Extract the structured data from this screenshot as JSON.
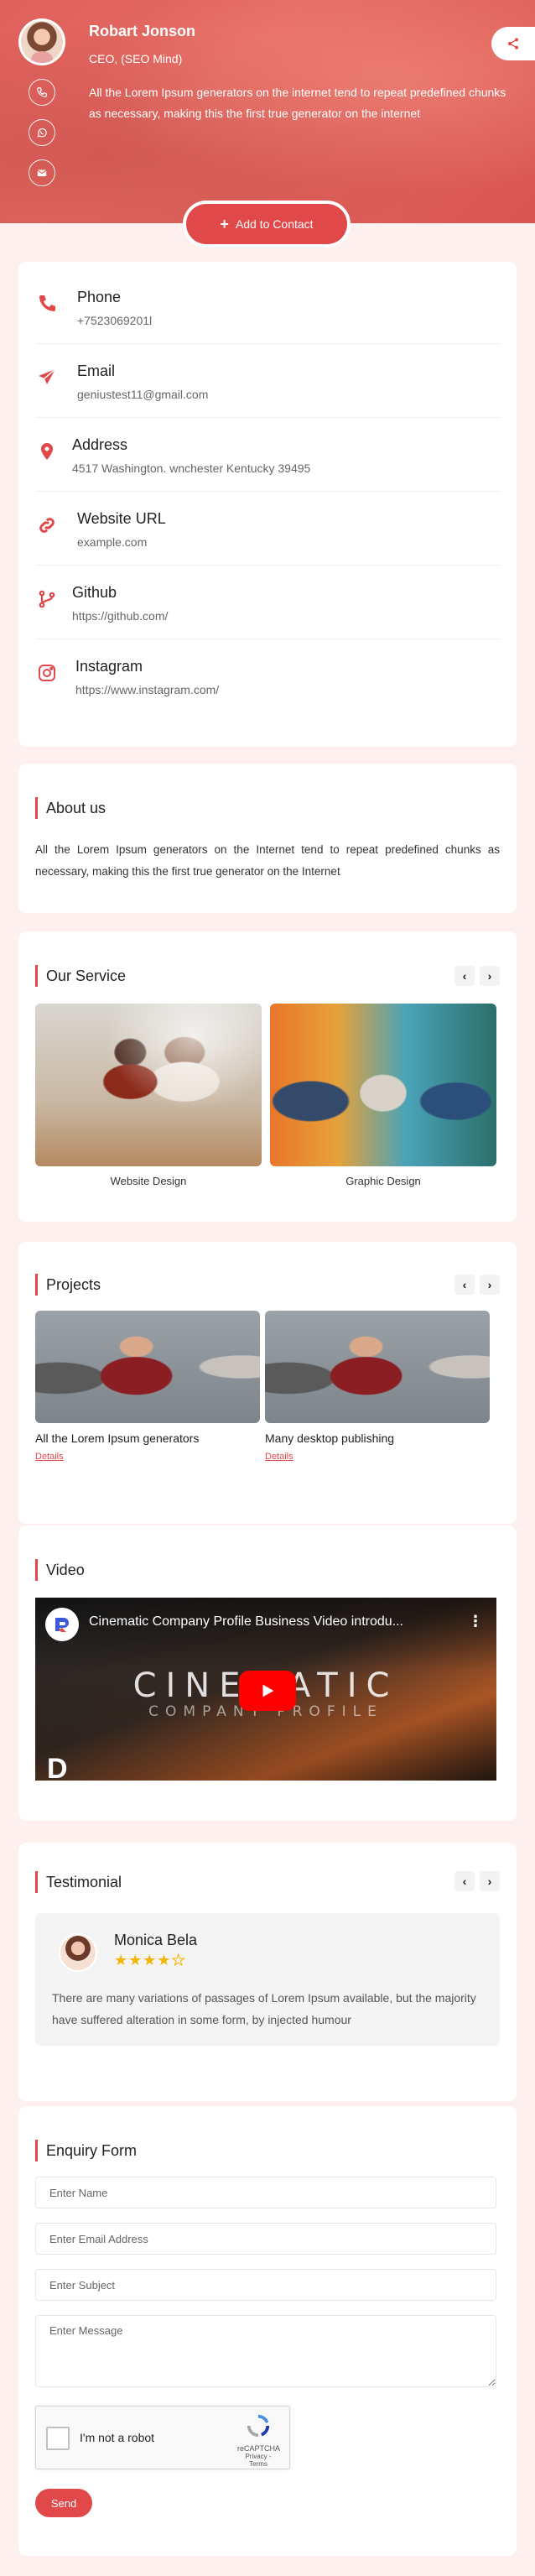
{
  "profile": {
    "name": "Robart Jonson",
    "role": "CEO, (SEO Mind)",
    "bio": "All the Lorem Ipsum generators on the internet tend to repeat predefined chunks as necessary, making this the first true generator on the internet",
    "add_contact_label": "Add to Contact"
  },
  "contacts": [
    {
      "label": "Phone",
      "value": "+7523069201l"
    },
    {
      "label": "Email",
      "value": "geniustest11@gmail.com"
    },
    {
      "label": "Address",
      "value": "4517 Washington. wnchester Kentucky 39495"
    },
    {
      "label": "Website URL",
      "value": "example.com"
    },
    {
      "label": "Github",
      "value": "https://github.com/"
    },
    {
      "label": "Instagram",
      "value": "https://www.instagram.com/"
    }
  ],
  "about": {
    "title": "About us",
    "text": "All the Lorem Ipsum generators on the Internet tend to repeat predefined chunks as necessary, making this the first true generator on the Internet"
  },
  "services": {
    "title": "Our Service",
    "items": [
      {
        "caption": "Website Design"
      },
      {
        "caption": "Graphic Design"
      }
    ]
  },
  "projects": {
    "title": "Projects",
    "items": [
      {
        "title": "All the Lorem Ipsum generators",
        "link": "Details"
      },
      {
        "title": "Many desktop publishing",
        "link": "Details"
      }
    ]
  },
  "video": {
    "title": "Video",
    "video_title": "Cinematic Company Profile Business Video introdu...",
    "overlay_line1": "CINEMATIC",
    "overlay_line2": "COMPANY PROFILE"
  },
  "testimonial": {
    "title": "Testimonial",
    "name": "Monica Bela",
    "rating": 4,
    "rating_max": 5,
    "text": "There are many variations of passages of Lorem Ipsum available, but the majority have suffered alteration in some form, by injected humour"
  },
  "enquiry": {
    "title": "Enquiry Form",
    "name_placeholder": "Enter Name",
    "email_placeholder": "Enter Email Address",
    "subject_placeholder": "Enter Subject",
    "message_placeholder": "Enter Message",
    "recaptcha_label": "I'm not a robot",
    "recaptcha_brand": "reCAPTCHA",
    "recaptcha_links": "Privacy - Terms",
    "send_label": "Send"
  },
  "colors": {
    "accent": "#e0484a",
    "header_bg": "#e0605c",
    "page_bg": "#fdf0ee",
    "star": "#f4b400"
  },
  "icons": {
    "phone": "phone-icon",
    "whatsapp": "whatsapp-icon",
    "email": "envelope-icon",
    "share": "share-icon",
    "address": "map-pin-icon",
    "website": "link-icon",
    "github": "git-branch-icon",
    "instagram": "instagram-icon"
  }
}
